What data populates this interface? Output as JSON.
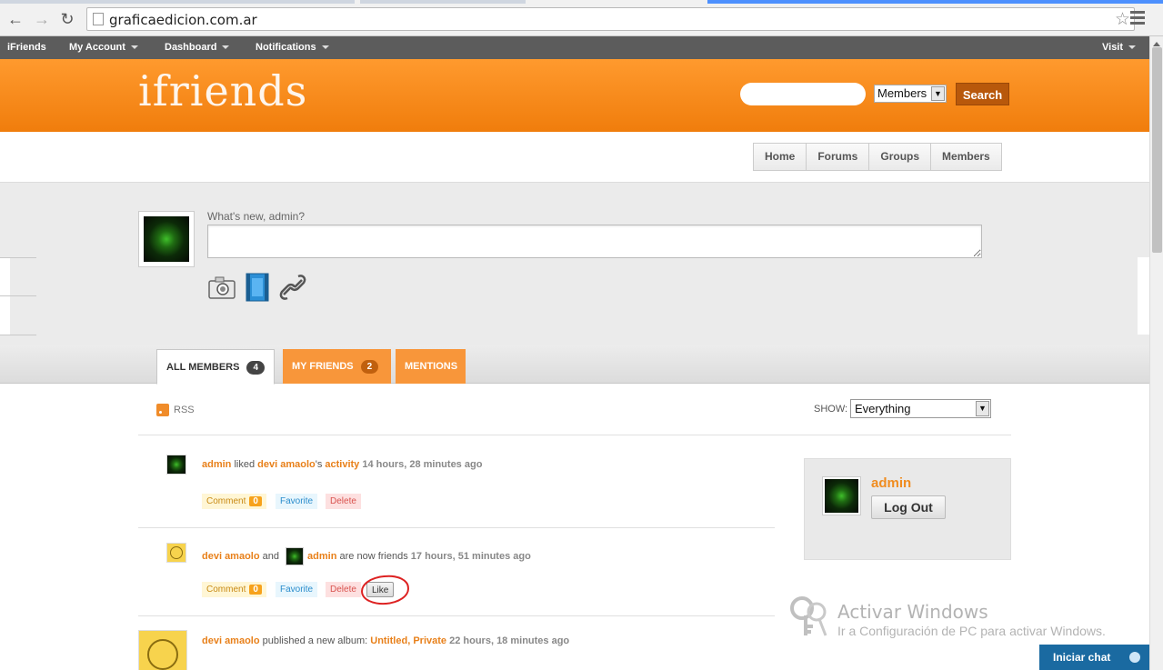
{
  "browser": {
    "url": "graficaedicion.com.ar"
  },
  "adminbar": {
    "brand": "iFriends",
    "my_account": "My Account",
    "dashboard": "Dashboard",
    "notifications": "Notifications",
    "visit": "Visit"
  },
  "header": {
    "logo": "ifriends",
    "search_placeholder": "",
    "search_scope": "Members",
    "search_button": "Search"
  },
  "nav": {
    "items": [
      "Home",
      "Forums",
      "Groups",
      "Members"
    ]
  },
  "whats_new": {
    "label": "What's new, admin?",
    "value": ""
  },
  "tabs": [
    {
      "label": "All Members",
      "count": "4"
    },
    {
      "label": "My Friends",
      "count": "2"
    },
    {
      "label": "Mentions",
      "count": ""
    }
  ],
  "filter": {
    "rss": "RSS",
    "show_label": "SHOW:",
    "show_value": "Everything"
  },
  "activity": [
    {
      "actor": "admin",
      "verb": " liked ",
      "target_user": "devi amaolo",
      "possessive": "'s ",
      "target": "activity",
      "time": "14 hours, 28 minutes ago",
      "comment_label": "Comment",
      "comment_count": "0",
      "favorite": "Favorite",
      "delete": "Delete"
    },
    {
      "actor": "devi amaolo",
      "conj": " and ",
      "friend": "admin",
      "verb": " are now friends ",
      "time": "17 hours, 51 minutes ago",
      "comment_label": "Comment",
      "comment_count": "0",
      "favorite": "Favorite",
      "delete": "Delete",
      "like": "Like"
    },
    {
      "actor": "devi amaolo",
      "verb": " published a new album: ",
      "album": "Untitled",
      "sep": ", ",
      "privacy": "Private",
      "time": "22 hours, 18 minutes ago"
    }
  ],
  "sidebar": {
    "user": "admin",
    "logout": "Log Out"
  },
  "watermark": {
    "title": "Activar Windows",
    "subtitle": "Ir a Configuración de PC para activar Windows."
  },
  "chat": {
    "label": "Iniciar chat"
  },
  "colors": {
    "orange": "#f08c1f",
    "header": "#f7891e",
    "adminbar": "#5c5c5c",
    "chat": "#1a6aa1"
  }
}
